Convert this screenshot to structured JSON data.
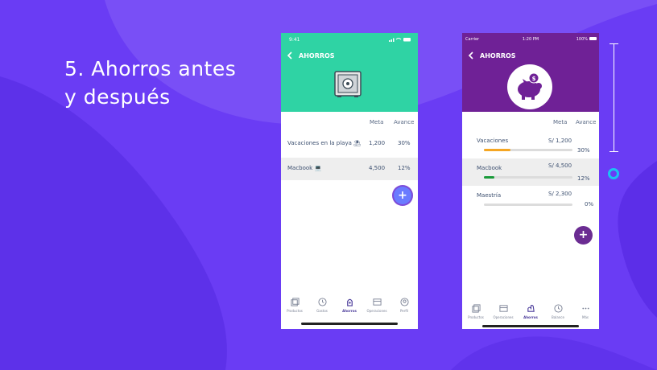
{
  "slide": {
    "title_line1": "5. Ahorros antes",
    "title_line2": "y después"
  },
  "colors": {
    "background": "#6a3cf4",
    "before_header": "#2fd3a4",
    "after_header": "#6f2196",
    "progress_orange": "#f5a623",
    "progress_green": "#1a9a3a"
  },
  "before": {
    "status": {
      "time": "9:41",
      "icons": "signal wifi battery"
    },
    "back_icon": "chevron-left-icon",
    "header_title": "AHORROS",
    "header_icon": "safe-icon",
    "columns": {
      "goal": "Meta",
      "progress": "Avance"
    },
    "rows": [
      {
        "name": "Vacaciones en la playa",
        "emoji": "⛱",
        "goal": "1,200",
        "progress": "30%"
      },
      {
        "name": "Macbook",
        "emoji": "💻",
        "goal": "4,500",
        "progress": "12%"
      }
    ],
    "fab_icon": "plus-icon",
    "tabs": [
      {
        "label": "Productos",
        "icon": "cards-icon"
      },
      {
        "label": "Gastos",
        "icon": "clock-icon"
      },
      {
        "label": "Ahorros",
        "icon": "piggy-icon",
        "active": true
      },
      {
        "label": "Operaciones",
        "icon": "wallet-icon"
      },
      {
        "label": "Perfil",
        "icon": "profile-icon"
      }
    ]
  },
  "after": {
    "status": {
      "carrier": "Carrier",
      "time": "1:20 PM",
      "battery": "100%"
    },
    "back_icon": "chevron-left-icon",
    "header_title": "AHORROS",
    "header_icon": "piggy-bank-icon",
    "columns": {
      "goal": "Meta",
      "progress": "Avance"
    },
    "rows": [
      {
        "name": "Vacaciones",
        "goal": "S/ 1,200",
        "progress": "30%",
        "fraction": 0.3
      },
      {
        "name": "Macbook",
        "goal": "S/ 4,500",
        "progress": "12%",
        "fraction": 0.12
      },
      {
        "name": "Maestría",
        "goal": "S/ 2,300",
        "progress": "0%",
        "fraction": 0
      }
    ],
    "fab_icon": "plus-icon",
    "tabs": [
      {
        "label": "Productos",
        "icon": "cards-icon"
      },
      {
        "label": "Operaciones",
        "icon": "wallet-icon"
      },
      {
        "label": "Ahorros",
        "icon": "piggy-icon",
        "active": true
      },
      {
        "label": "Balance",
        "icon": "clock-icon"
      },
      {
        "label": "Más",
        "icon": "more-icon"
      }
    ]
  }
}
